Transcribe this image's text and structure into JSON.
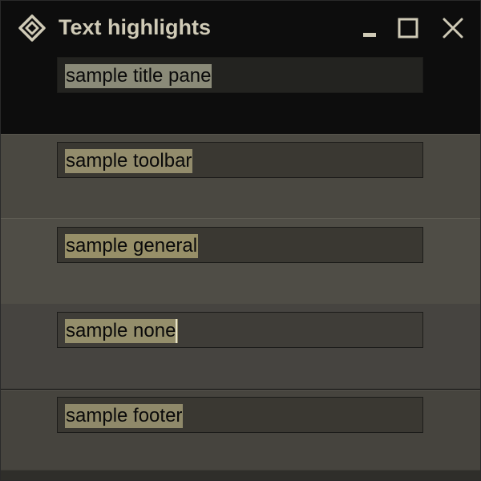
{
  "window": {
    "title": "Text highlights",
    "buttons": {
      "minimize": "minimize",
      "maximize": "maximize",
      "close": "close"
    }
  },
  "fields": [
    {
      "id": "title-pane",
      "text": "sample title pane"
    },
    {
      "id": "toolbar",
      "text": "sample toolbar"
    },
    {
      "id": "general",
      "text": "sample general"
    },
    {
      "id": "none",
      "text": "sample none"
    },
    {
      "id": "footer",
      "text": "sample footer"
    }
  ],
  "colors": {
    "title_text": "#cfcab6",
    "titlebar_bg": "#0d0d0d",
    "highlight": "#978f68"
  }
}
